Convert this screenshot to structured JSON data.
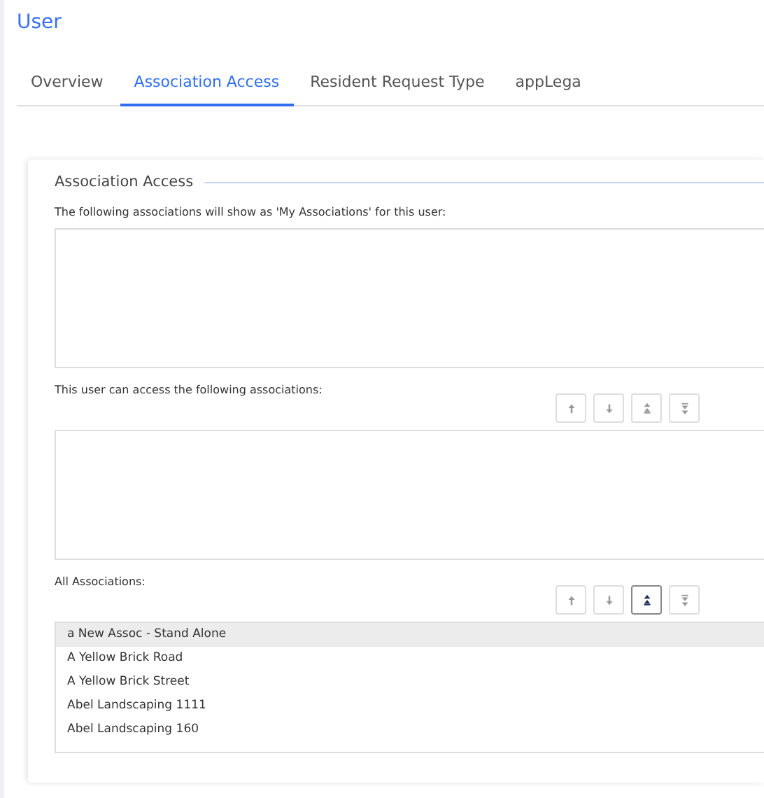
{
  "page_title": "User",
  "tabs": [
    {
      "label": "Overview",
      "selected": false
    },
    {
      "label": "Association Access",
      "selected": true
    },
    {
      "label": "Resident Request Type",
      "selected": false
    },
    {
      "label": "appLega",
      "selected": false
    }
  ],
  "section": {
    "title": "Association Access",
    "lists": [
      {
        "label": "The following associations will show as 'My Associations' for this user:"
      },
      {
        "label": "This user can access the following associations:",
        "controls": [
          {
            "kind": "up",
            "disabled": true
          },
          {
            "kind": "down",
            "disabled": true
          },
          {
            "kind": "top",
            "disabled": true
          },
          {
            "kind": "bottom",
            "disabled": true
          }
        ]
      },
      {
        "label": "All Associations:",
        "controls": [
          {
            "kind": "up",
            "disabled": true
          },
          {
            "kind": "down",
            "disabled": true
          },
          {
            "kind": "top",
            "disabled": false
          },
          {
            "kind": "bottom",
            "disabled": true
          }
        ],
        "items": [
          {
            "text": "a New Assoc - Stand Alone",
            "selected": true
          },
          {
            "text": "A Yellow Brick Road",
            "selected": false
          },
          {
            "text": "A Yellow Brick Street",
            "selected": false
          },
          {
            "text": "Abel Landscaping 1111",
            "selected": false
          },
          {
            "text": "Abel Landscaping 160",
            "selected": false
          }
        ]
      }
    ]
  }
}
